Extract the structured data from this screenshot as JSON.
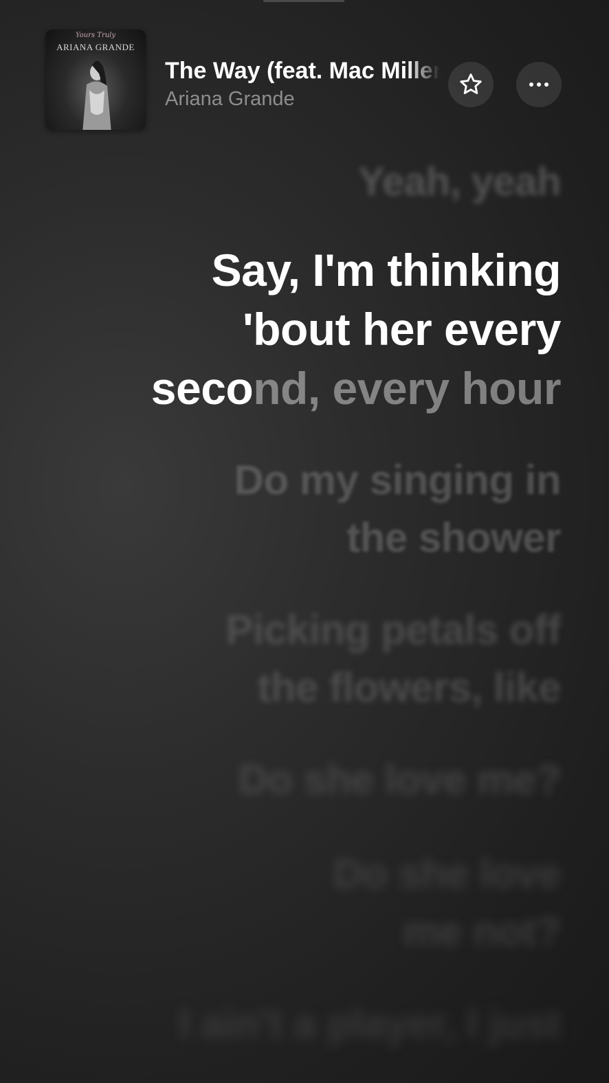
{
  "now_playing": {
    "title": "The Way (feat. Mac Miller)",
    "artist": "Ariana Grande",
    "album_art": {
      "script_text": "Yours Truly",
      "name_text": "ARIANA GRANDE"
    }
  },
  "actions": {
    "favorite_icon": "star-icon",
    "more_icon": "ellipsis-icon"
  },
  "lyrics": {
    "previous": "Yeah, yeah",
    "current_sung": "Say, I'm thinking\n'bout her every\nseco",
    "current_unsung": "nd, every hour",
    "upcoming": [
      "Do my singing in\nthe shower",
      "Picking petals off\nthe flowers, like",
      "Do she love me?",
      "Do she love\nme not?",
      "I ain't a player, I just"
    ]
  },
  "colors": {
    "background": "#2a2a2a",
    "active_lyric": "#ffffff",
    "artist_text": "#8e8e8e"
  }
}
